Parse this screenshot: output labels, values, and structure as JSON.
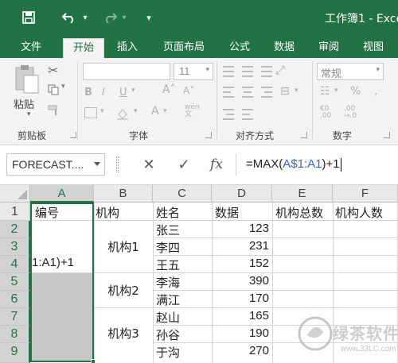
{
  "titlebar": {
    "title": "工作簿1 - Exce",
    "save_icon": "save-icon",
    "undo_icon": "undo-icon",
    "redo_icon": "redo-icon"
  },
  "tabs": [
    "文件",
    "开始",
    "插入",
    "页面布局",
    "公式",
    "数据",
    "审阅",
    "视图"
  ],
  "active_tab": "开始",
  "ribbon": {
    "paste_label": "粘贴",
    "font_size": "11",
    "number_format": "常规",
    "groups": [
      "剪贴板",
      "字体",
      "对齐方式",
      "数字"
    ]
  },
  "formula_bar": {
    "name_box": "FORECAST....",
    "cancel_glyph": "✕",
    "enter_glyph": "✓",
    "fx_label": "fx",
    "formula_prefix": "=MAX(",
    "formula_ref": "A$1:A1",
    "formula_suffix": ")+1"
  },
  "sheet": {
    "columns": [
      "A",
      "B",
      "C",
      "D",
      "E",
      "F"
    ],
    "rows": [
      "1",
      "2",
      "3",
      "4",
      "5",
      "6",
      "7",
      "8",
      "9"
    ],
    "header_cells": {
      "A1": "编号",
      "B1": "机构",
      "C1": "姓名",
      "D1": "数据",
      "E1": "机构总数",
      "F1": "机构人数"
    },
    "editing_cell_text": "1:A1)+1",
    "groups": [
      {
        "org": "机构1",
        "members": [
          {
            "name": "张三",
            "value": "123"
          },
          {
            "name": "李四",
            "value": "231"
          },
          {
            "name": "王五",
            "value": "152"
          }
        ]
      },
      {
        "org": "机构2",
        "members": [
          {
            "name": "李海",
            "value": "390"
          },
          {
            "name": "满江",
            "value": "170"
          }
        ]
      },
      {
        "org": "机构3",
        "members": [
          {
            "name": "赵山",
            "value": "165"
          },
          {
            "name": "孙谷",
            "value": "190"
          },
          {
            "name": "于沟",
            "value": "270"
          }
        ]
      }
    ]
  },
  "watermark": {
    "main": "绿茶软件园",
    "url": "www.33LC.com"
  }
}
